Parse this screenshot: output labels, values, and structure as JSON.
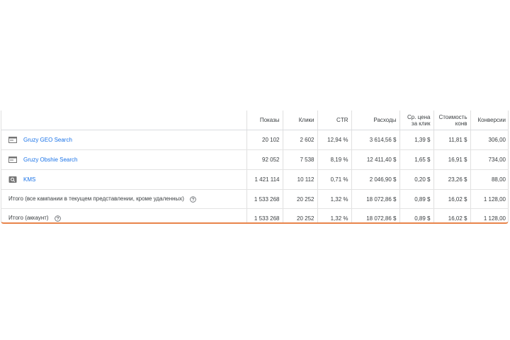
{
  "table": {
    "headers": {
      "impressions": "Показы",
      "clicks": "Клики",
      "ctr": "CTR",
      "cost": "Расходы",
      "avg_cpc": "Ср. цена за клик",
      "cost_per_conv": "Стоимость конв",
      "conversions": "Конверсии"
    },
    "rows": [
      {
        "icon": "search-campaign-icon",
        "name": "Gruzy GEO Search",
        "impressions": "20 102",
        "clicks": "2 602",
        "ctr": "12,94 %",
        "cost": "3 614,56 $",
        "avg_cpc": "1,39 $",
        "cost_per_conv": "11,81 $",
        "conversions": "306,00"
      },
      {
        "icon": "search-campaign-icon",
        "name": "Gruzy Obshie Search",
        "impressions": "92 052",
        "clicks": "7 538",
        "ctr": "8,19 %",
        "cost": "12 411,40 $",
        "avg_cpc": "1,65 $",
        "cost_per_conv": "16,91 $",
        "conversions": "734,00"
      },
      {
        "icon": "display-campaign-icon",
        "name": "KMS",
        "impressions": "1 421 114",
        "clicks": "10 112",
        "ctr": "0,71 %",
        "cost": "2 046,90 $",
        "avg_cpc": "0,20 $",
        "cost_per_conv": "23,26 $",
        "conversions": "88,00"
      }
    ],
    "totals": [
      {
        "label": "Итого (все кампании в текущем представлении, кроме удаленных)",
        "impressions": "1 533 268",
        "clicks": "20 252",
        "ctr": "1,32 %",
        "cost": "18 072,86 $",
        "avg_cpc": "0,89 $",
        "cost_per_conv": "16,02 $",
        "conversions": "1 128,00"
      },
      {
        "label": "Итого (аккаунт)",
        "impressions": "1 533 268",
        "clicks": "20 252",
        "ctr": "1,32 %",
        "cost": "18 072,86 $",
        "avg_cpc": "0,89 $",
        "cost_per_conv": "16,02 $",
        "conversions": "1 128,00"
      }
    ]
  },
  "colors": {
    "link": "#1a73e8",
    "text": "#3c4043",
    "border": "#e0e0e0",
    "accent_bottom": "#e8844a",
    "icon_gray": "#757575"
  }
}
